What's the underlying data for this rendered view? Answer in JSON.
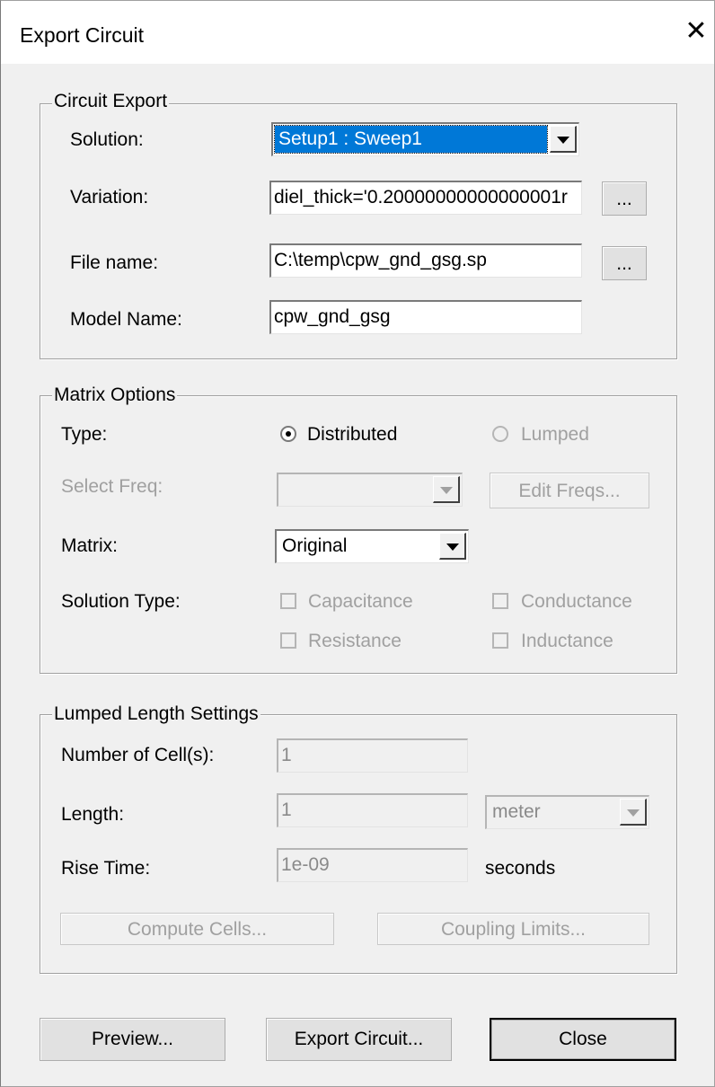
{
  "window": {
    "title": "Export Circuit",
    "close_glyph": "✕"
  },
  "circuit_export": {
    "legend": "Circuit Export",
    "solution_label": "Solution:",
    "solution_value": "Setup1 : Sweep1",
    "variation_label": "Variation:",
    "variation_value": "diel_thick='0.20000000000000001r",
    "variation_browse": "...",
    "filename_label": "File name:",
    "filename_value": "C:\\temp\\cpw_gnd_gsg.sp",
    "filename_browse": "...",
    "modelname_label": "Model Name:",
    "modelname_value": "cpw_gnd_gsg"
  },
  "matrix_options": {
    "legend": "Matrix Options",
    "type_label": "Type:",
    "type_distributed": "Distributed",
    "type_lumped": "Lumped",
    "type_selected": "Distributed",
    "select_freq_label": "Select Freq:",
    "select_freq_value": "",
    "edit_freqs": "Edit Freqs...",
    "matrix_label": "Matrix:",
    "matrix_value": "Original",
    "solution_type_label": "Solution Type:",
    "capacitance": "Capacitance",
    "conductance": "Conductance",
    "resistance": "Resistance",
    "inductance": "Inductance"
  },
  "lumped_length": {
    "legend": "Lumped Length Settings",
    "cells_label": "Number of Cell(s):",
    "cells_value": "1",
    "length_label": "Length:",
    "length_value": "1",
    "length_unit": "meter",
    "rise_label": "Rise Time:",
    "rise_value": "1e-09",
    "rise_unit": "seconds",
    "compute_cells": "Compute Cells...",
    "coupling_limits": "Coupling Limits..."
  },
  "footer": {
    "preview": "Preview...",
    "export": "Export Circuit...",
    "close": "Close"
  }
}
